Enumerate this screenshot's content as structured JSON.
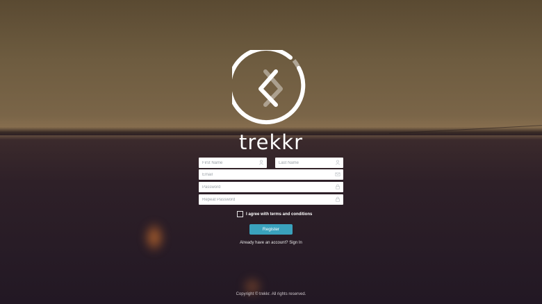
{
  "brand": {
    "name": "trekkr"
  },
  "form": {
    "first_name_placeholder": "First Name",
    "last_name_placeholder": "Last Name",
    "email_placeholder": "Email",
    "password_placeholder": "Password",
    "repeat_password_placeholder": "Repeat Password",
    "terms_label": "I agree with terms and conditions",
    "register_label": "Register",
    "signin_prompt": "Already have an account?",
    "signin_link": "Sign In"
  },
  "footer": {
    "copyright": "Copyright © trekkr. All rights reserved."
  },
  "icons": {
    "first_name": "user-icon",
    "last_name": "user-icon",
    "email": "envelope-icon",
    "password": "lock-icon",
    "repeat_password": "lock-icon",
    "logo": "chevron-left-circle-icon"
  },
  "colors": {
    "accent": "#3aa2bd"
  }
}
